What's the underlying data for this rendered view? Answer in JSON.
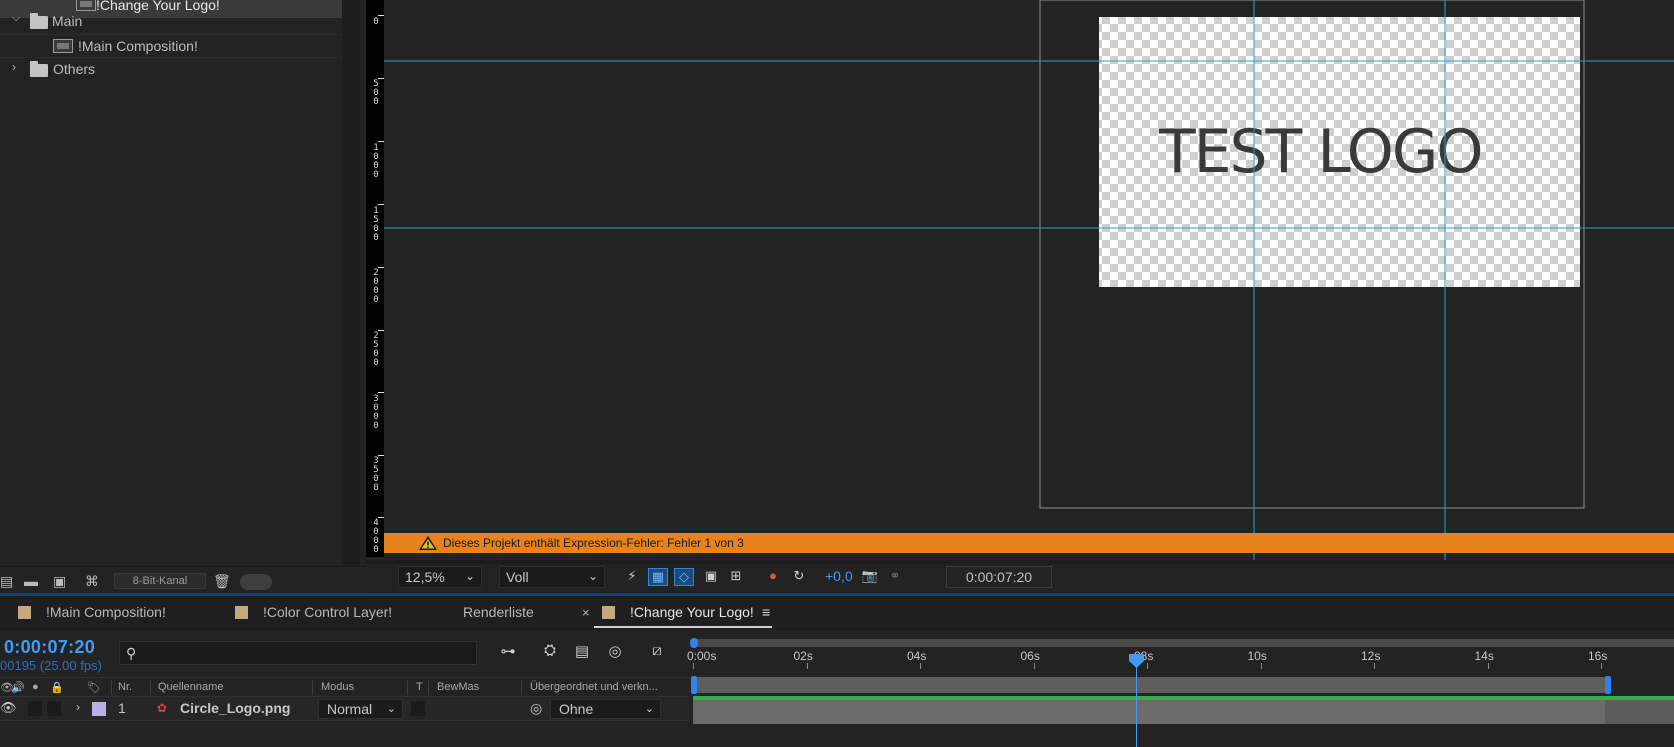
{
  "project": {
    "items": [
      {
        "label": "!Change Your Logo!",
        "type": "composition"
      },
      {
        "label": "Main",
        "type": "folder"
      },
      {
        "label": "!Main Composition!",
        "type": "composition"
      },
      {
        "label": "Others",
        "type": "folder"
      }
    ],
    "bit_depth": "8-Bit-Kanal"
  },
  "viewer": {
    "logo_text": "TEST LOGO",
    "ruler_labels": [
      "0",
      "500",
      "1000",
      "1500",
      "2000",
      "2500",
      "3000",
      "3500",
      "4000"
    ],
    "error_message": "Dieses Projekt enthält Expression-Fehler: Fehler 1 von 3",
    "zoom": "12,5%",
    "resolution": "Voll",
    "exposure": "+0,0",
    "current_time": "0:00:07:20"
  },
  "timeline": {
    "tabs": [
      {
        "label": "!Main Composition!",
        "active": false
      },
      {
        "label": "!Color Control Layer!",
        "active": false
      },
      {
        "label": "Renderliste",
        "active": false
      },
      {
        "label": "!Change Your Logo!",
        "active": true
      }
    ],
    "close_glyph": "×",
    "menu_glyph": "≡",
    "timecode": "0:00:07:20",
    "frame_info": "00195 (25.00 fps)",
    "columns": {
      "nr": "Nr.",
      "source_name": "Quellenname",
      "mode": "Modus",
      "t": "T",
      "trkmat": "BewMas",
      "parent": "Übergeordnet und verkn..."
    },
    "layers": [
      {
        "nr": "1",
        "name": "Circle_Logo.png",
        "mode": "Normal",
        "parent": "Ohne",
        "label_color": "#b9b0e6"
      }
    ],
    "ruler": [
      "0:00s",
      "02s",
      "04s",
      "06s",
      "08s",
      "10s",
      "12s",
      "14s",
      "16s"
    ],
    "playhead_seconds": 7.8
  },
  "colors": {
    "accent": "#3f9bf5",
    "error_bar": "#e8821a",
    "layer_bar": "#6b6b6b",
    "layer_top": "#2fb24a"
  }
}
